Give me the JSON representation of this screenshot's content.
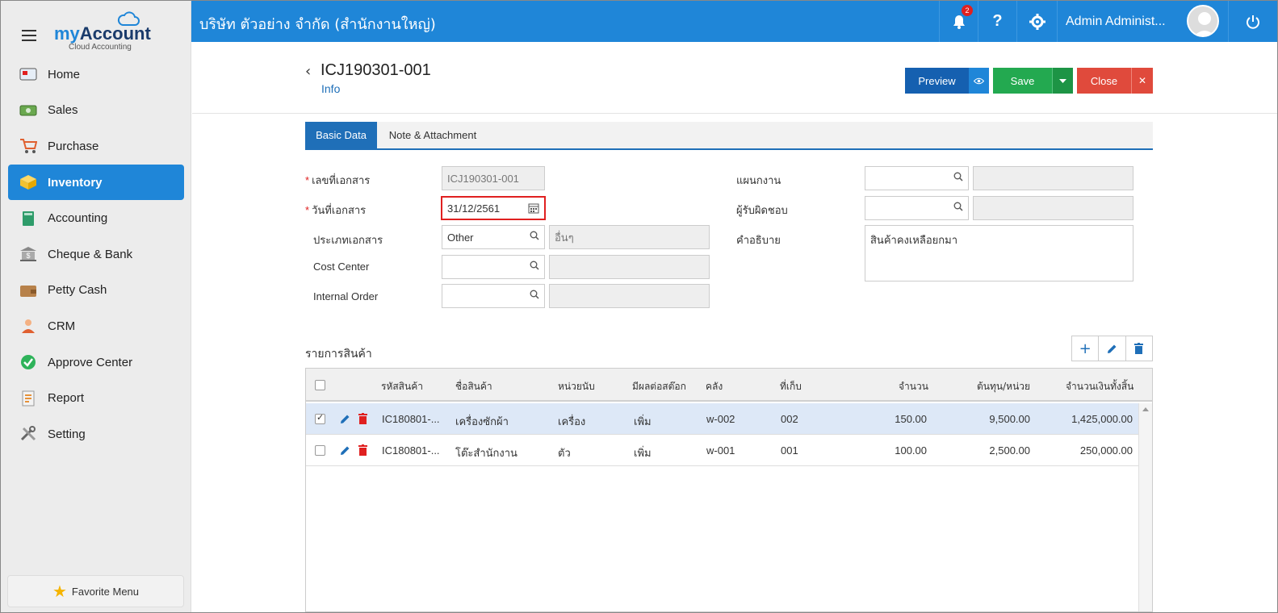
{
  "app": {
    "logo_my": "my",
    "logo_account": "Account",
    "logo_sub": "Cloud Accounting",
    "company": "บริษัท ตัวอย่าง จำกัด (สำนักงานใหญ่)",
    "notification_count": "2",
    "user_name": "Admin Administ...",
    "brand_color": "#1f86d8"
  },
  "sidebar": {
    "items": [
      {
        "label": "Home",
        "icon": "home-icon"
      },
      {
        "label": "Sales",
        "icon": "sales-icon"
      },
      {
        "label": "Purchase",
        "icon": "cart-icon"
      },
      {
        "label": "Inventory",
        "icon": "box-icon"
      },
      {
        "label": "Accounting",
        "icon": "book-icon"
      },
      {
        "label": "Cheque & Bank",
        "icon": "bank-icon"
      },
      {
        "label": "Petty Cash",
        "icon": "wallet-icon"
      },
      {
        "label": "CRM",
        "icon": "people-icon"
      },
      {
        "label": "Approve Center",
        "icon": "check-icon"
      },
      {
        "label": "Report",
        "icon": "report-icon"
      },
      {
        "label": "Setting",
        "icon": "tools-icon"
      }
    ],
    "active_index": 3,
    "favorite": "Favorite Menu"
  },
  "header": {
    "doc_no": "ICJ190301-001",
    "subtitle": "Info",
    "preview": "Preview",
    "save": "Save",
    "close": "Close"
  },
  "tabs": [
    "Basic Data",
    "Note & Attachment"
  ],
  "form": {
    "doc_no_label": "เลขที่เอกสาร",
    "doc_no_value": "ICJ190301-001",
    "doc_date_label": "วันที่เอกสาร",
    "doc_date_value": "31/12/2561",
    "doc_type_label": "ประเภทเอกสาร",
    "doc_type_value": "Other",
    "doc_type_desc": "อื่นๆ",
    "cost_center_label": "Cost Center",
    "internal_order_label": "Internal Order",
    "department_label": "แผนกงาน",
    "responsible_label": "ผู้รับผิดชอบ",
    "description_label": "คำอธิบาย",
    "description_value": "สินค้าคงเหลือยกมา"
  },
  "items": {
    "title": "รายการสินค้า",
    "columns": [
      "รหัสสินค้า",
      "ชื่อสินค้า",
      "หน่วยนับ",
      "มีผลต่อสต๊อก",
      "คลัง",
      "ที่เก็บ",
      "จำนวน",
      "ต้นทุน/หน่วย",
      "จำนวนเงินทั้งสิ้น"
    ],
    "rows": [
      {
        "code": "IC180801-...",
        "name": "เครื่องซักผ้า",
        "unit": "เครื่อง",
        "stock": "เพิ่ม",
        "warehouse": "w-002",
        "location": "002",
        "qty": "150.00",
        "cost": "9,500.00",
        "total": "1,425,000.00",
        "checked": true
      },
      {
        "code": "IC180801-...",
        "name": "โต๊ะสำนักงาน",
        "unit": "ตัว",
        "stock": "เพิ่ม",
        "warehouse": "w-001",
        "location": "001",
        "qty": "100.00",
        "cost": "2,500.00",
        "total": "250,000.00",
        "checked": false
      }
    ]
  }
}
